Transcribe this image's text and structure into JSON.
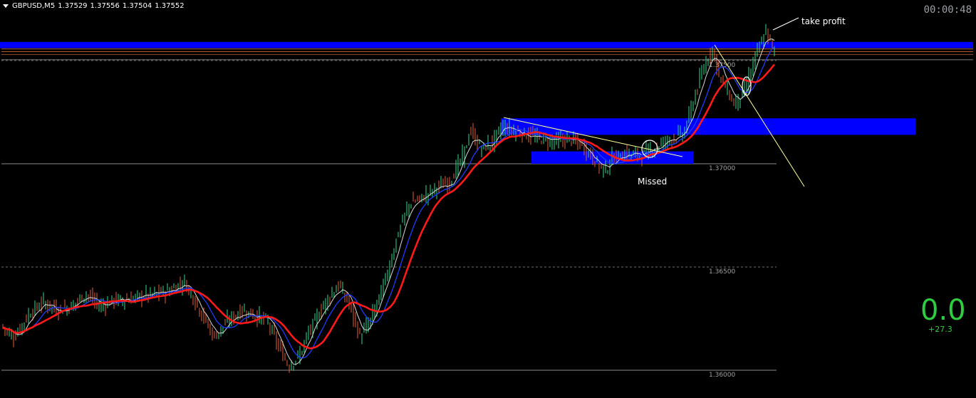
{
  "header": {
    "symbol": "GBPUSD,M5",
    "open": "1.37529",
    "high": "1.37556",
    "low": "1.37504",
    "close": "1.37552"
  },
  "clock": "00:00:48",
  "pnl": {
    "value": "0.0",
    "delta": "+27.3"
  },
  "annotations": {
    "take_profit": "take profit",
    "missed": "Missed"
  },
  "colors": {
    "background": "#000000",
    "zone": "#0000ff",
    "ma_slow": "#ff1a1a",
    "ma_mid": "#1f3cff",
    "ma_fast": "#d8d8d8",
    "trendline": "#ffff99",
    "resistance_lines": "#ff8c3a",
    "pnl": "#2ecc40"
  },
  "chart_data": {
    "type": "candlestick",
    "symbol": "GBPUSD",
    "timeframe": "M5",
    "price_labels": [
      "1.37500",
      "1.37000",
      "1.36500",
      "1.36000"
    ],
    "ylim": [
      1.3595,
      1.3773
    ],
    "series": [
      {
        "style": "slow moving average",
        "color": "#ff1a1a"
      },
      {
        "style": "mid moving average",
        "color": "#1f3cff"
      },
      {
        "style": "fast moving average",
        "color": "#d8d8d8"
      }
    ],
    "close_path": [
      [
        0,
        1.3622
      ],
      [
        20,
        1.3616
      ],
      [
        40,
        1.3627
      ],
      [
        60,
        1.3633
      ],
      [
        80,
        1.3629
      ],
      [
        100,
        1.3631
      ],
      [
        120,
        1.3637
      ],
      [
        140,
        1.3631
      ],
      [
        160,
        1.3634
      ],
      [
        180,
        1.3634
      ],
      [
        200,
        1.3636
      ],
      [
        220,
        1.3637
      ],
      [
        240,
        1.3639
      ],
      [
        258,
        1.3643
      ],
      [
        270,
        1.3636
      ],
      [
        285,
        1.3626
      ],
      [
        300,
        1.3616
      ],
      [
        320,
        1.3624
      ],
      [
        340,
        1.3629
      ],
      [
        360,
        1.3626
      ],
      [
        375,
        1.3624
      ],
      [
        390,
        1.3612
      ],
      [
        405,
        1.3602
      ],
      [
        420,
        1.3607
      ],
      [
        430,
        1.3616
      ],
      [
        445,
        1.3626
      ],
      [
        460,
        1.3635
      ],
      [
        475,
        1.3641
      ],
      [
        490,
        1.3632
      ],
      [
        505,
        1.3616
      ],
      [
        520,
        1.3624
      ],
      [
        540,
        1.3643
      ],
      [
        560,
        1.3668
      ],
      [
        575,
        1.3681
      ],
      [
        590,
        1.3683
      ],
      [
        610,
        1.3688
      ],
      [
        630,
        1.3691
      ],
      [
        650,
        1.3704
      ],
      [
        660,
        1.3716
      ],
      [
        675,
        1.3707
      ],
      [
        690,
        1.371
      ],
      [
        705,
        1.3718
      ],
      [
        720,
        1.3716
      ],
      [
        740,
        1.3714
      ],
      [
        760,
        1.3712
      ],
      [
        780,
        1.3711
      ],
      [
        800,
        1.3712
      ],
      [
        820,
        1.3708
      ],
      [
        840,
        1.3699
      ],
      [
        850,
        1.3697
      ],
      [
        860,
        1.3703
      ],
      [
        880,
        1.3705
      ],
      [
        900,
        1.3704
      ],
      [
        920,
        1.3708
      ],
      [
        940,
        1.3712
      ],
      [
        960,
        1.3715
      ],
      [
        975,
        1.3733
      ],
      [
        990,
        1.3749
      ],
      [
        1000,
        1.3756
      ],
      [
        1010,
        1.3742
      ],
      [
        1020,
        1.3736
      ],
      [
        1030,
        1.3729
      ],
      [
        1045,
        1.3735
      ],
      [
        1060,
        1.3752
      ],
      [
        1075,
        1.3764
      ],
      [
        1085,
        1.3755
      ]
    ],
    "zones": [
      {
        "from_x": 0,
        "to_x": 1366,
        "low": 1.3756,
        "high": 1.3759
      },
      {
        "from_x": 703,
        "to_x": 1285,
        "low": 1.3714,
        "high": 1.3722
      },
      {
        "from_x": 746,
        "to_x": 973,
        "low": 1.37,
        "high": 1.3706
      }
    ],
    "reference_lines": [
      1.37556,
      1.37543,
      1.37529,
      1.37504,
      1.37,
      1.35997
    ]
  }
}
